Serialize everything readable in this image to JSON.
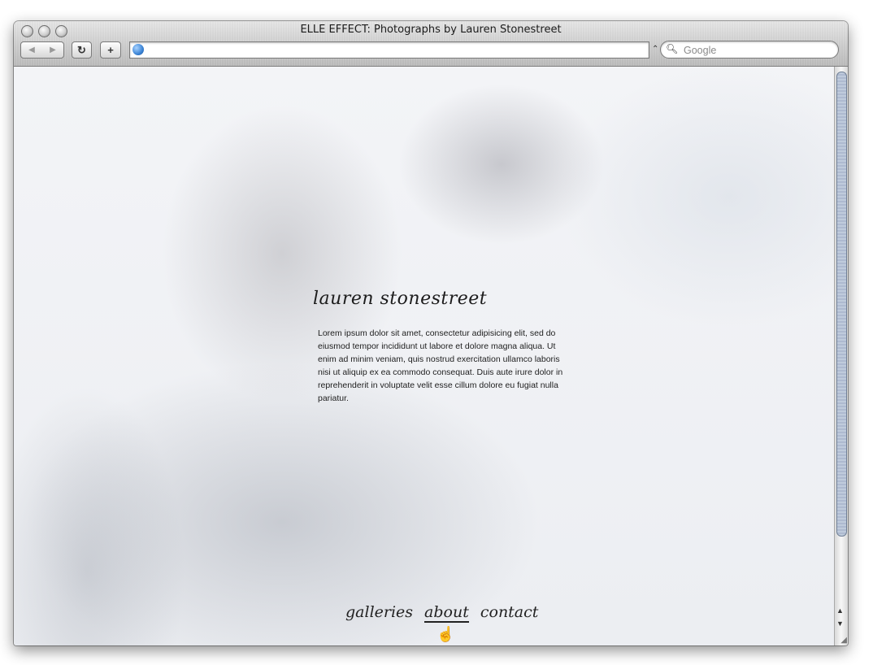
{
  "window": {
    "title": "ELLE EFFECT: Photographs by Lauren Stonestreet"
  },
  "toolbar": {
    "back_icon": "◀",
    "forward_icon": "▶",
    "reload_icon": "↻",
    "add_icon": "+",
    "url_value": "",
    "search_placeholder": "Google"
  },
  "page": {
    "signature": "lauren stonestreet",
    "bio": "Lorem ipsum dolor sit amet, consectetur adipisicing elit, sed do eiusmod tempor incididunt ut labore et dolore magna aliqua. Ut enim ad minim veniam, quis nostrud exercitation ullamco laboris nisi ut aliquip ex ea commodo consequat. Duis aute irure dolor in reprehenderit in voluptate velit esse cillum dolore eu fugiat nulla pariatur.",
    "nav": {
      "galleries": "galleries",
      "about": "about",
      "contact": "contact"
    }
  },
  "icons": {
    "search": "search-icon",
    "globe": "globe-icon",
    "hand_cursor": "hand-cursor-icon"
  }
}
